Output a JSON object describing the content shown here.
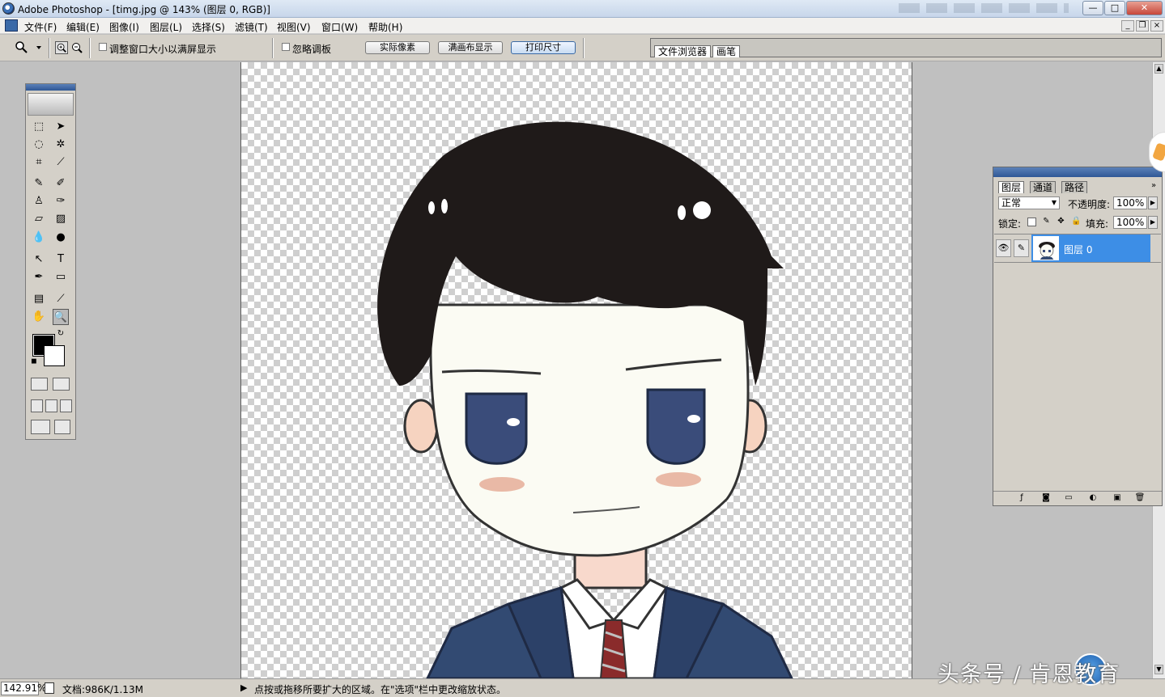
{
  "window": {
    "title": "Adobe Photoshop - [timg.jpg @ 143% (图层 0, RGB)]",
    "controls": {
      "minimize": "—",
      "maximize": "□",
      "close": "✕"
    },
    "doc_controls": {
      "minimize": "_",
      "restore": "❐",
      "close": "×"
    }
  },
  "menu": [
    "文件(F)",
    "编辑(E)",
    "图像(I)",
    "图层(L)",
    "选择(S)",
    "滤镜(T)",
    "视图(V)",
    "窗口(W)",
    "帮助(H)"
  ],
  "options": {
    "resize_window_label": "调整窗口大小以满屏显示",
    "ignore_palettes_label": "忽略调板",
    "actual_pixels": "实际像素",
    "fit_on_screen": "满画布显示",
    "print_size": "打印尺寸"
  },
  "palette_well": {
    "tabs": [
      "文件浏览器",
      "画笔"
    ]
  },
  "layers_panel": {
    "tabs": [
      "图层",
      "通道",
      "路径"
    ],
    "blend_mode": "正常",
    "opacity_label": "不透明度:",
    "opacity": "100%",
    "lock_label": "锁定:",
    "fill_label": "填充:",
    "fill": "100%",
    "layer_name": "图层 0"
  },
  "status": {
    "zoom": "142.91%",
    "doc_info": "文档:986K/1.13M",
    "hint": "点按或拖移所要扩大的区域。在\"选项\"栏中更改缩放状态。"
  },
  "watermark": "头条号 / 肯恩教育",
  "colors": {
    "foreground": "#000000",
    "background": "#ffffff",
    "hair": "#1f1a19",
    "skin": "#fbfbf3",
    "suit": "#324a72",
    "eye": "#3a4c7a",
    "blush": "#e9b9a6",
    "tie": "#8a2b2b",
    "selection": "#3d8ee6"
  }
}
